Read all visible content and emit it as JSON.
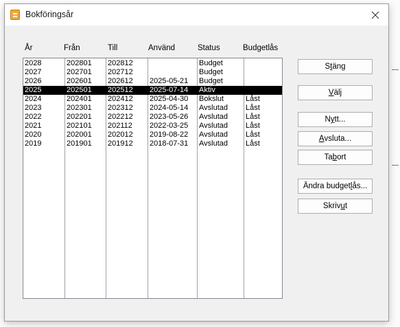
{
  "window": {
    "title": "Bokföringsår",
    "accent": "#f0a83a"
  },
  "table": {
    "headers": [
      "År",
      "Från",
      "Till",
      "Använd",
      "Status",
      "Budgetlås"
    ],
    "rows": [
      [
        "2028",
        "202801",
        "202812",
        "",
        "Budget",
        ""
      ],
      [
        "2027",
        "202701",
        "202712",
        "",
        "Budget",
        ""
      ],
      [
        "2026",
        "202601",
        "202612",
        "2025-05-21",
        "Budget",
        ""
      ],
      [
        "2025",
        "202501",
        "202512",
        "2025-07-14",
        "Aktiv",
        ""
      ],
      [
        "2024",
        "202401",
        "202412",
        "2025-04-30",
        "Bokslut",
        "Låst"
      ],
      [
        "2023",
        "202301",
        "202312",
        "2024-05-14",
        "Avslutad",
        "Låst"
      ],
      [
        "2022",
        "202201",
        "202212",
        "2023-05-26",
        "Avslutad",
        "Låst"
      ],
      [
        "2021",
        "202101",
        "202112",
        "2022-03-25",
        "Avslutad",
        "Låst"
      ],
      [
        "2020",
        "202001",
        "202012",
        "2019-08-22",
        "Avslutad",
        "Låst"
      ],
      [
        "2019",
        "201901",
        "201912",
        "2018-07-31",
        "Avslutad",
        "Låst"
      ]
    ],
    "selected_row": "2025"
  },
  "buttons": [
    {
      "name": "stang-button",
      "label": "Stäng",
      "mnemonic": "t"
    },
    {
      "name": "valj-button",
      "label": "Välj",
      "mnemonic": "V"
    },
    {
      "name": "nytt-button",
      "label": "Nytt...",
      "mnemonic": "y"
    },
    {
      "name": "avsluta-button",
      "label": "Avsluta...",
      "mnemonic": "A"
    },
    {
      "name": "ta-bort-button",
      "label": "Ta bort",
      "mnemonic": "b"
    },
    {
      "name": "andra-budgetlas-button",
      "label": "Ändra budgetlås...",
      "mnemonic": "l"
    },
    {
      "name": "skriv-ut-button",
      "label": "Skriv ut",
      "mnemonic": "u"
    }
  ]
}
